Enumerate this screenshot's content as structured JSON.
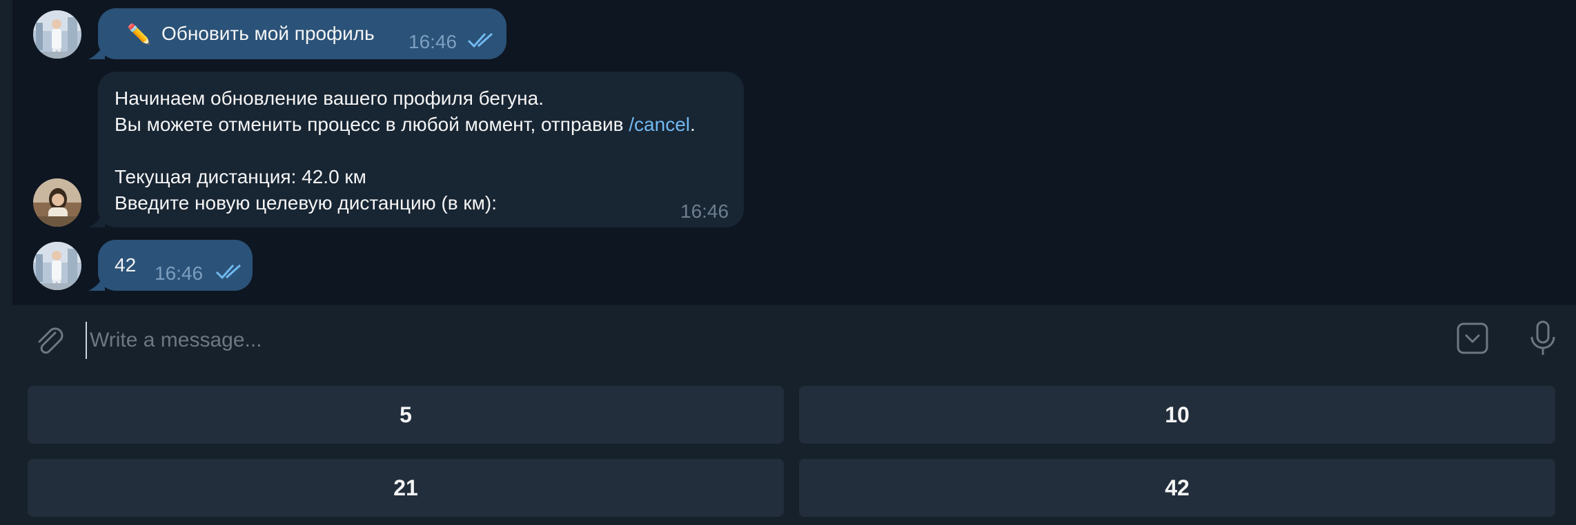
{
  "messages": [
    {
      "id": "m1",
      "direction": "outgoing",
      "emoji": "✏️",
      "text": "Обновить мой профиль",
      "time": "16:46",
      "status": "read"
    },
    {
      "id": "m2",
      "direction": "incoming",
      "lines": {
        "l1": "Начинаем обновление вашего профиля бегуна.",
        "l2_before": "Вы можете отменить процесс в любой момент, отправив ",
        "l2_link": "/cancel",
        "l2_after": ".",
        "l3": "Текущая дистанция: 42.0 км",
        "l4": "Введите новую целевую дистанцию (в км):"
      },
      "time": "16:46"
    },
    {
      "id": "m3",
      "direction": "outgoing",
      "text": "42",
      "time": "16:46",
      "status": "read"
    }
  ],
  "composer": {
    "placeholder": "Write a message..."
  },
  "keyboard": {
    "buttons": [
      {
        "label": "5"
      },
      {
        "label": "10"
      },
      {
        "label": "21"
      },
      {
        "label": "42"
      }
    ]
  },
  "colors": {
    "outgoing_bubble": "#2b5278",
    "incoming_bubble": "#182533",
    "background": "#0e1621",
    "link": "#71baf2",
    "panel": "#17212b",
    "keyboard_button": "#232e3c"
  }
}
